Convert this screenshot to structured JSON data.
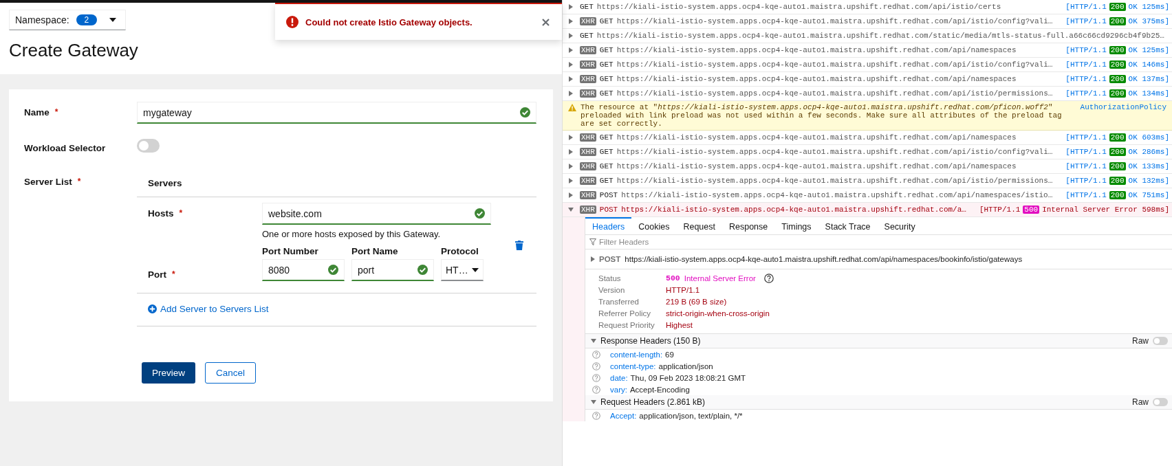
{
  "namespace": {
    "label": "Namespace:",
    "count": "2"
  },
  "toast": {
    "message": "Could not create Istio Gateway objects."
  },
  "title": "Create Gateway",
  "form": {
    "name": {
      "label": "Name",
      "required": "*",
      "value": "mygateway",
      "valid": true
    },
    "workload_selector": {
      "label": "Workload Selector",
      "on": false
    },
    "server_list": {
      "label": "Server List",
      "required": "*",
      "heading": "Servers",
      "hosts": {
        "label": "Hosts",
        "required": "*",
        "value": "website.com",
        "valid": true,
        "helper": "One or more hosts exposed by this Gateway."
      },
      "port": {
        "label": "Port",
        "required": "*",
        "fields": [
          {
            "label": "Port Number",
            "value": "8080",
            "kind": "text",
            "valid": true
          },
          {
            "label": "Port Name",
            "value": "port",
            "kind": "text",
            "valid": true
          },
          {
            "label": "Protocol",
            "value": "HT…",
            "kind": "select",
            "valid": false
          }
        ]
      },
      "add_link": "Add Server to Servers List"
    },
    "buttons": [
      {
        "label": "Preview",
        "kind": "primary"
      },
      {
        "label": "Cancel",
        "kind": "secondary"
      }
    ]
  },
  "network": {
    "entries": [
      {
        "kind": "request",
        "expanded": false,
        "error": false,
        "method": "GET",
        "url": "https://kiali-istio-system.apps.ocp4-kqe-auto1.maistra.upshift.redhat.com/api/istio/certs",
        "protocol": "[HTTP/1.1",
        "status": "200",
        "result": "OK 125ms]"
      },
      {
        "kind": "request",
        "initiator": "XHR",
        "expanded": false,
        "error": false,
        "method": "GET",
        "url": "https://kiali-istio-system.apps.ocp4-kqe-auto1.maistra.upshift.redhat.com/api/istio/config?vali…",
        "protocol": "[HTTP/1.1",
        "status": "200",
        "result": "OK 375ms]"
      },
      {
        "kind": "request",
        "expanded": false,
        "error": false,
        "method": "GET",
        "url": "https://kiali-istio-system.apps.ocp4-kqe-auto1.maistra.upshift.redhat.com/static/media/mtls-status-full.a66c66cd9296cb4f9b25…"
      },
      {
        "kind": "request",
        "initiator": "XHR",
        "expanded": false,
        "error": false,
        "method": "GET",
        "url": "https://kiali-istio-system.apps.ocp4-kqe-auto1.maistra.upshift.redhat.com/api/namespaces",
        "protocol": "[HTTP/1.1",
        "status": "200",
        "result": "OK 125ms]"
      },
      {
        "kind": "request",
        "initiator": "XHR",
        "expanded": false,
        "error": false,
        "method": "GET",
        "url": "https://kiali-istio-system.apps.ocp4-kqe-auto1.maistra.upshift.redhat.com/api/istio/config?vali…",
        "protocol": "[HTTP/1.1",
        "status": "200",
        "result": "OK 146ms]"
      },
      {
        "kind": "request",
        "initiator": "XHR",
        "expanded": false,
        "error": false,
        "method": "GET",
        "url": "https://kiali-istio-system.apps.ocp4-kqe-auto1.maistra.upshift.redhat.com/api/namespaces",
        "protocol": "[HTTP/1.1",
        "status": "200",
        "result": "OK 137ms]"
      },
      {
        "kind": "request",
        "initiator": "XHR",
        "expanded": false,
        "error": false,
        "method": "GET",
        "url": "https://kiali-istio-system.apps.ocp4-kqe-auto1.maistra.upshift.redhat.com/api/istio/permissions…",
        "protocol": "[HTTP/1.1",
        "status": "200",
        "result": "OK 134ms]"
      },
      {
        "kind": "warning",
        "text": "The resource at \"*https://kiali-istio-system.apps.ocp4-kqe-auto1.maistra.upshift.redhat.com/pficon.woff2*\" preloaded with link preload was not used within a few seconds. Make sure all attributes of the preload tag are set correctly.",
        "source": "AuthorizationPolicy"
      },
      {
        "kind": "request",
        "initiator": "XHR",
        "expanded": false,
        "error": false,
        "method": "GET",
        "url": "https://kiali-istio-system.apps.ocp4-kqe-auto1.maistra.upshift.redhat.com/api/namespaces",
        "protocol": "[HTTP/1.1",
        "status": "200",
        "result": "OK 603ms]"
      },
      {
        "kind": "request",
        "initiator": "XHR",
        "expanded": false,
        "error": false,
        "method": "GET",
        "url": "https://kiali-istio-system.apps.ocp4-kqe-auto1.maistra.upshift.redhat.com/api/istio/config?vali…",
        "protocol": "[HTTP/1.1",
        "status": "200",
        "result": "OK 286ms]"
      },
      {
        "kind": "request",
        "initiator": "XHR",
        "expanded": false,
        "error": false,
        "method": "GET",
        "url": "https://kiali-istio-system.apps.ocp4-kqe-auto1.maistra.upshift.redhat.com/api/namespaces",
        "protocol": "[HTTP/1.1",
        "status": "200",
        "result": "OK 133ms]"
      },
      {
        "kind": "request",
        "initiator": "XHR",
        "expanded": false,
        "error": false,
        "method": "GET",
        "url": "https://kiali-istio-system.apps.ocp4-kqe-auto1.maistra.upshift.redhat.com/api/istio/permissions…",
        "protocol": "[HTTP/1.1",
        "status": "200",
        "result": "OK 132ms]"
      },
      {
        "kind": "request",
        "initiator": "XHR",
        "expanded": false,
        "error": false,
        "method": "POST",
        "url": "https://kiali-istio-system.apps.ocp4-kqe-auto1.maistra.upshift.redhat.com/api/namespaces/istio…",
        "protocol": "[HTTP/1.1",
        "status": "200",
        "result": "OK 751ms]"
      },
      {
        "kind": "request",
        "initiator": "XHR",
        "expanded": true,
        "error": true,
        "method": "POST",
        "url": "https://kiali-istio-system.apps.ocp4-kqe-auto1.maistra.upshift.redhat.com/a…",
        "protocol": "[HTTP/1.1",
        "status": "500",
        "result": "Internal Server Error 598ms]"
      }
    ]
  },
  "details": {
    "tabs": [
      {
        "label": "Headers",
        "selected": true
      },
      {
        "label": "Cookies",
        "selected": false
      },
      {
        "label": "Request",
        "selected": false
      },
      {
        "label": "Response",
        "selected": false
      },
      {
        "label": "Timings",
        "selected": false
      },
      {
        "label": "Stack Trace",
        "selected": false
      },
      {
        "label": "Security",
        "selected": false
      }
    ],
    "filter": {
      "placeholder": "Filter Headers"
    },
    "request_line": {
      "method": "POST",
      "url": "https://kiali-istio-system.apps.ocp4-kqe-auto1.maistra.upshift.redhat.com/api/namespaces/bookinfo/istio/gateways"
    },
    "summary": [
      {
        "label": "Status",
        "code": "500",
        "value": "Internal Server Error",
        "kind": "status"
      },
      {
        "label": "Version",
        "value": "HTTP/1.1",
        "kind": "text"
      },
      {
        "label": "Transferred",
        "value": "219 B (69 B size)",
        "kind": "text"
      },
      {
        "label": "Referrer Policy",
        "value": "strict-origin-when-cross-origin",
        "kind": "text"
      },
      {
        "label": "Request Priority",
        "value": "Highest",
        "kind": "text"
      }
    ],
    "sections": [
      {
        "title": "Response Headers (150 B)",
        "raw_label": "Raw",
        "raw": false,
        "headers": [
          {
            "name": "content-length:",
            "value": "69"
          },
          {
            "name": "content-type:",
            "value": "application/json"
          },
          {
            "name": "date:",
            "value": "Thu, 09 Feb 2023 18:08:21 GMT"
          },
          {
            "name": "vary:",
            "value": "Accept-Encoding"
          }
        ]
      },
      {
        "title": "Request Headers (2.861 kB)",
        "raw_label": "Raw",
        "raw": false,
        "headers": [
          {
            "name": "Accept:",
            "value": "application/json, text/plain, */*"
          }
        ]
      }
    ]
  }
}
